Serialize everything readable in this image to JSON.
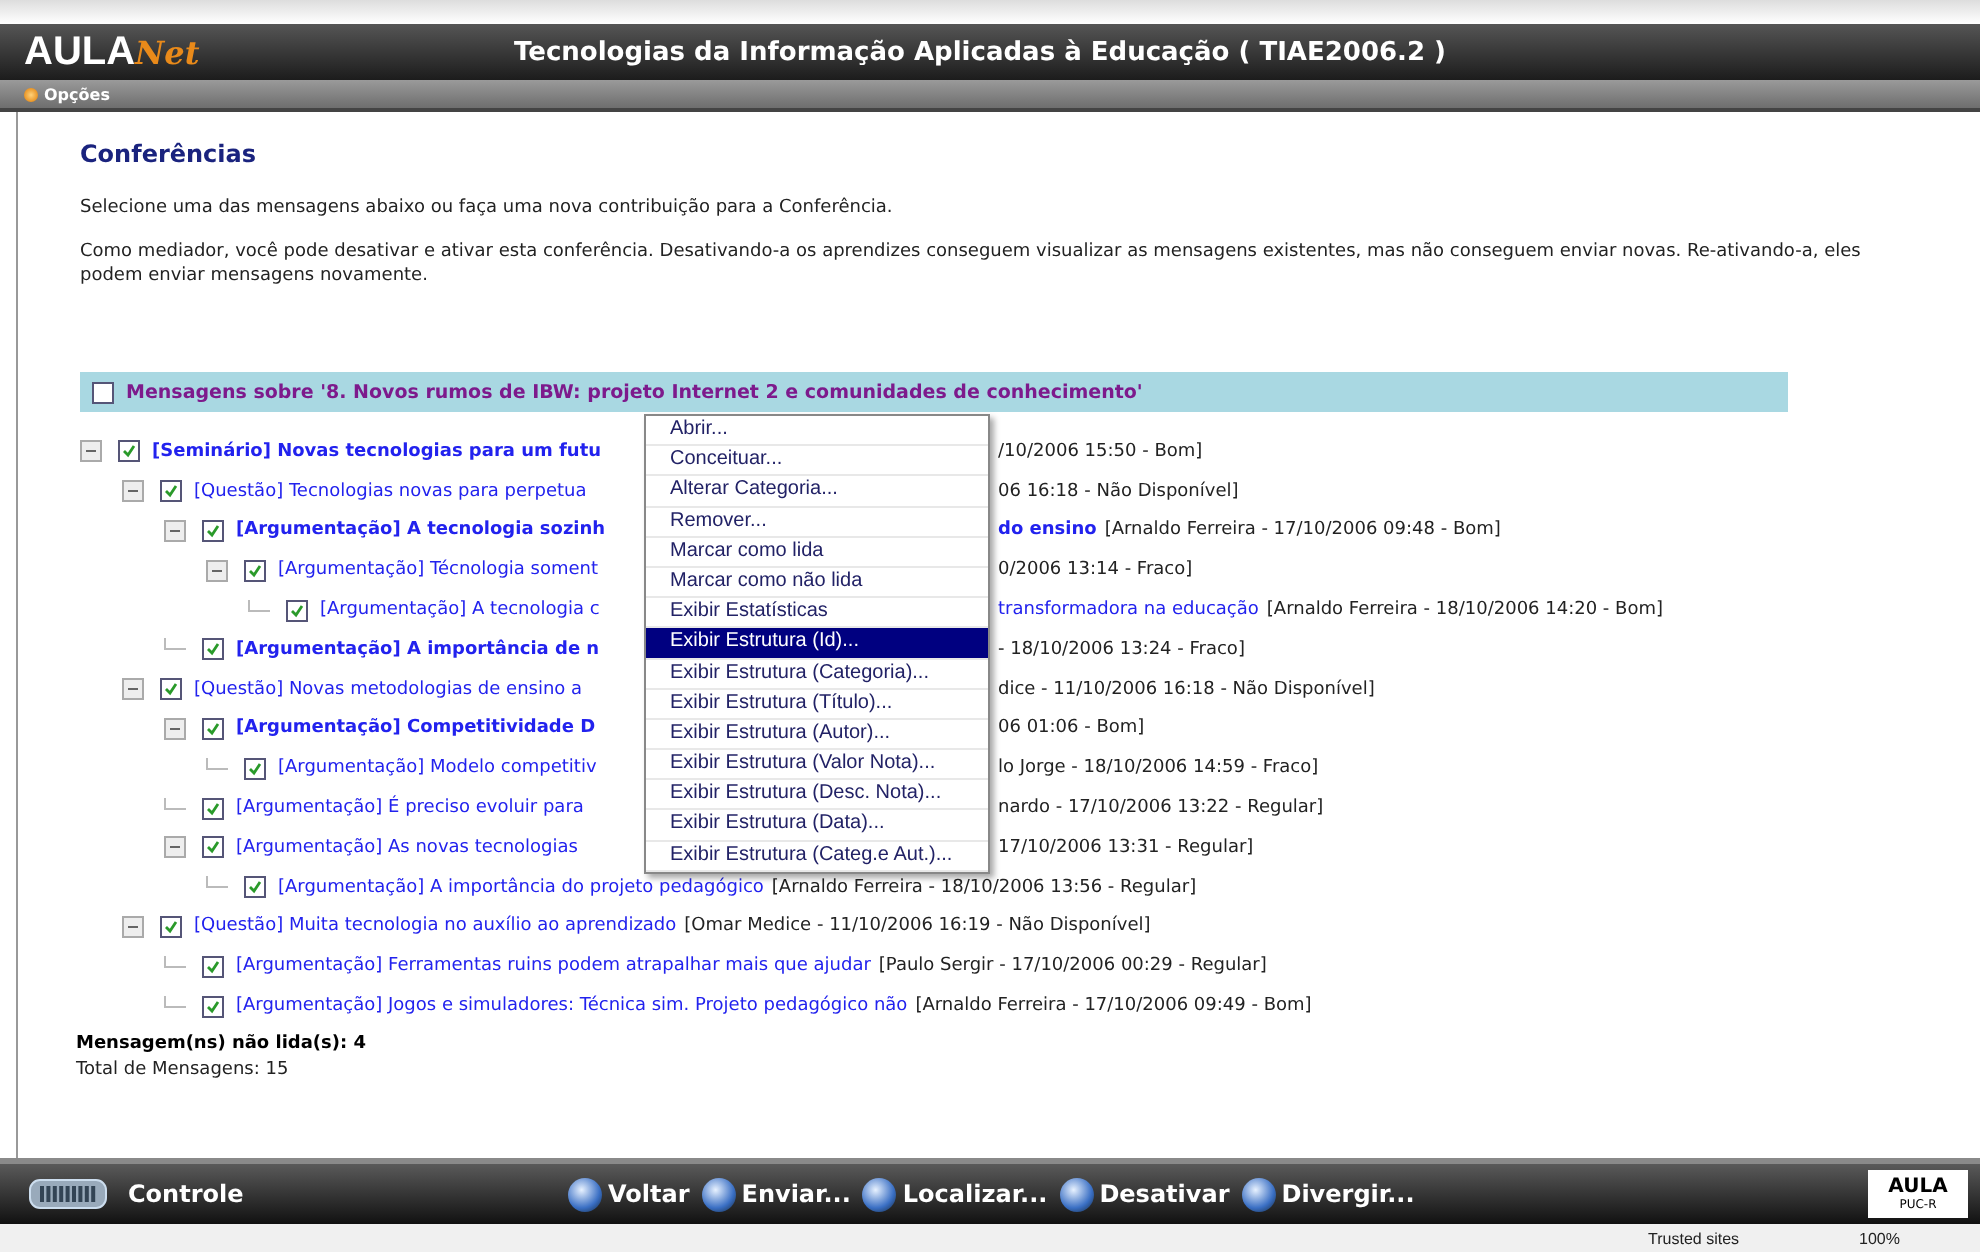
{
  "window": {
    "title": "Tecnologias da Informação Aplicadas à Educação ( TIAE2006.2 )"
  },
  "logo": {
    "text": "AULA",
    "script": "Net"
  },
  "options_menu": {
    "label": "Opções"
  },
  "page": {
    "heading": "Conferências",
    "intro": "Selecione uma das mensagens abaixo ou faça uma nova contribuição para a Conferência.",
    "note": "Como mediador, você pode desativar e ativar esta conferência. Desativando-a os aprendizes conseguem visualizar as mensagens existentes, mas não conseguem enviar novas. Re-ativando-a, eles podem enviar mensagens novamente."
  },
  "conference": {
    "title": "Mensagens sobre '8. Novos rumos de IBW: projeto Internet 2 e comunidades de conhecimento'",
    "checked": false
  },
  "messages": [
    {
      "title": "[Seminário] Novas tecnologias para um futu",
      "meta": "/10/2006 15:50 - Bom]",
      "bold": true,
      "checked": true,
      "covered": true,
      "expanded": true,
      "children": [
        {
          "title": "[Questão] Tecnologias novas para perpetua",
          "meta": "06 16:18 - Não Disponível]",
          "bold": false,
          "checked": true,
          "covered": true,
          "expanded": true,
          "children": [
            {
              "title": "[Argumentação] A tecnologia sozinh",
              "continued": "do ensino",
              "meta": "[Arnaldo Ferreira - 17/10/2006 09:48 - Bom]",
              "bold": true,
              "checked": true,
              "covered": true,
              "expanded": true,
              "children": [
                {
                  "title": "[Argumentação] Técnologia soment",
                  "meta": "0/2006 13:14 - Fraco]",
                  "bold": false,
                  "checked": true,
                  "covered": true,
                  "expanded": true,
                  "children": [
                    {
                      "title": "[Argumentação] A tecnologia c",
                      "continued": "transformadora na educação",
                      "meta": "[Arnaldo Ferreira - 18/10/2006 14:20 - Bom]",
                      "bold": false,
                      "checked": true,
                      "covered": true
                    }
                  ]
                }
              ]
            },
            {
              "title": "[Argumentação] A importância de n",
              "meta": "- 18/10/2006 13:24 - Fraco]",
              "bold": true,
              "checked": true,
              "covered": true
            }
          ]
        },
        {
          "title": "[Questão] Novas metodologias de ensino a",
          "meta": "dice - 11/10/2006 16:18 - Não Disponível]",
          "bold": false,
          "checked": true,
          "covered": true,
          "expanded": true,
          "children": [
            {
              "title": "[Argumentação] Competitividade D",
              "meta": "06 01:06 - Bom]",
              "bold": true,
              "checked": true,
              "covered": true,
              "expanded": true,
              "children": [
                {
                  "title": "[Argumentação] Modelo competitiv",
                  "meta": "lo Jorge - 18/10/2006 14:59 - Fraco]",
                  "bold": false,
                  "checked": true,
                  "covered": true
                }
              ]
            },
            {
              "title": "[Argumentação] É preciso evoluir para",
              "meta": "nardo - 17/10/2006 13:22 - Regular]",
              "bold": false,
              "checked": true,
              "covered": true
            },
            {
              "title": "[Argumentação] As novas tecnologias",
              "meta": "17/10/2006 13:31 - Regular]",
              "bold": false,
              "checked": true,
              "covered": true,
              "expanded": true,
              "children": [
                {
                  "title": "[Argumentação] A importância do projeto pedagógico",
                  "meta": "[Arnaldo Ferreira - 18/10/2006 13:56 - Regular]",
                  "bold": false,
                  "checked": true,
                  "covered": false
                }
              ]
            }
          ]
        },
        {
          "title": "[Questão] Muita tecnologia no auxílio ao aprendizado",
          "meta": "[Omar Medice - 11/10/2006 16:19 - Não Disponível]",
          "bold": false,
          "checked": true,
          "covered": false,
          "expanded": true,
          "children": [
            {
              "title": "[Argumentação] Ferramentas ruins podem atrapalhar mais que ajudar",
              "meta": "[Paulo Sergir - 17/10/2006 00:29 - Regular]",
              "bold": false,
              "checked": true,
              "covered": false
            },
            {
              "title": "[Argumentação] Jogos e simuladores: Técnica sim. Projeto pedagógico não",
              "meta": "[Arnaldo Ferreira - 17/10/2006 09:49 - Bom]",
              "bold": false,
              "checked": true,
              "covered": false
            }
          ]
        }
      ]
    }
  ],
  "context_menu": {
    "items": [
      {
        "label": "Abrir...",
        "selected": false
      },
      {
        "label": "Conceituar...",
        "selected": false
      },
      {
        "label": "Alterar Categoria...",
        "selected": false
      },
      {
        "label": "Remover...",
        "selected": false
      },
      {
        "label": "Marcar como lida",
        "selected": false
      },
      {
        "label": "Marcar como não lida",
        "selected": false
      },
      {
        "label": "Exibir Estatísticas",
        "selected": false
      },
      {
        "label": "Exibir Estrutura (Id)...",
        "selected": true
      },
      {
        "label": "Exibir Estrutura (Categoria)...",
        "selected": false
      },
      {
        "label": "Exibir Estrutura (Título)...",
        "selected": false
      },
      {
        "label": "Exibir Estrutura (Autor)...",
        "selected": false
      },
      {
        "label": "Exibir Estrutura (Valor Nota)...",
        "selected": false
      },
      {
        "label": "Exibir Estrutura (Desc. Nota)...",
        "selected": false
      },
      {
        "label": "Exibir Estrutura (Data)...",
        "selected": false
      },
      {
        "label": "Exibir Estrutura (Categ.e Aut.)...",
        "selected": false
      }
    ]
  },
  "summary": {
    "unread": "Mensagem(ns) não lida(s): 4",
    "total": "Total de Mensagens: 15"
  },
  "toolbar": {
    "control": "Controle",
    "buttons": [
      "Voltar",
      "Enviar...",
      "Localizar...",
      "Desativar",
      "Divergir..."
    ]
  },
  "footer_logo": {
    "text": "AULA",
    "caption": "PUC-R"
  },
  "status_bar": {
    "zone": "Trusted sites",
    "zoom": "100%"
  }
}
